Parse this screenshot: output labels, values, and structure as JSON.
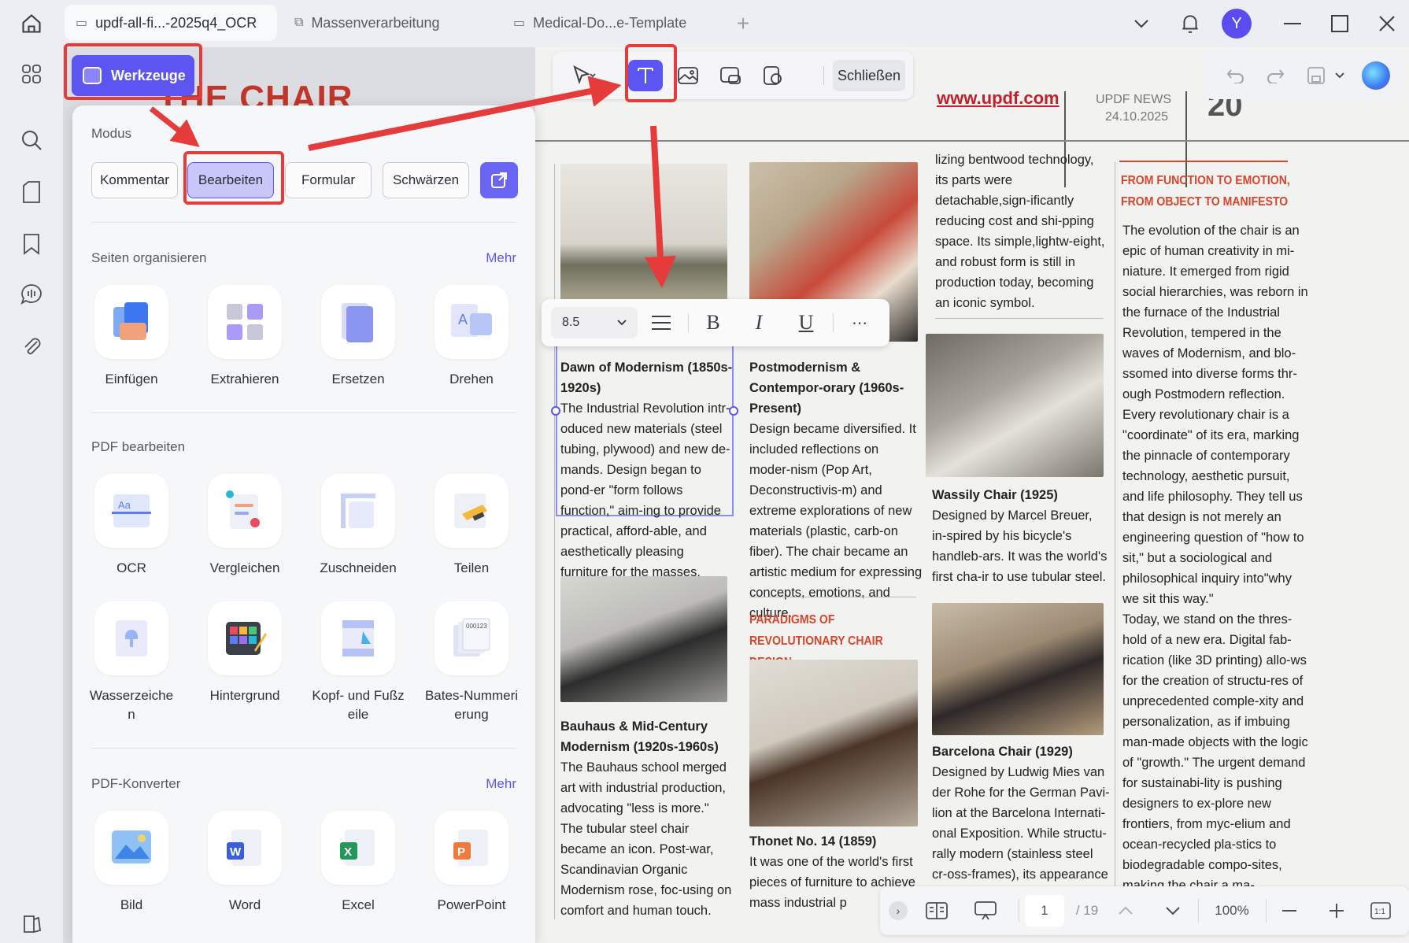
{
  "tabs": [
    {
      "label": "updf-all-fi...-2025q4_OCR",
      "active": true
    },
    {
      "label": "Massenverarbeitung",
      "active": false
    },
    {
      "label": "Medical-Do...e-Template",
      "active": false
    }
  ],
  "user": {
    "avatar_letter": "Y"
  },
  "toolbar": {
    "werkzeuge_label": "Werkzeuge",
    "close_label": "Schließen"
  },
  "panel": {
    "mode_title": "Modus",
    "modes": [
      "Kommentar",
      "Bearbeiten",
      "Formular",
      "Schwärzen"
    ],
    "active_mode": "Bearbeiten",
    "organize": {
      "title": "Seiten organisieren",
      "more": "Mehr",
      "tools": [
        "Einfügen",
        "Extrahieren",
        "Ersetzen",
        "Drehen"
      ]
    },
    "edit": {
      "title": "PDF bearbeiten",
      "tools": [
        "OCR",
        "Vergleichen",
        "Zuschneiden",
        "Teilen",
        "Wasserzeiche n",
        "Hintergrund",
        "Kopf- und Fußzeile",
        "Bates-Nummerierung"
      ]
    },
    "convert": {
      "title": "PDF-Konverter",
      "more": "Mehr",
      "tools": [
        "Bild",
        "Word",
        "Excel",
        "PowerPoint"
      ]
    }
  },
  "format_bar": {
    "font_size": "8.5"
  },
  "document": {
    "header_partial": "THE CHAIR",
    "url": "www.updf.com",
    "news_label": "UPDF NEWS",
    "date": "24.10.2025",
    "issue": "20",
    "col1": {
      "h1": "Dawn of Modernism (1850s-1920s)",
      "p1": "The Industrial Revolution intr-oduced new materials (steel tubing, plywood) and new de-mands. Design began to pond-er \"form follows function,\" aim-ing to provide practical, afford-able, and aesthetically pleasing furniture for the masses.",
      "h2": "Bauhaus & Mid-Century Modernism (1920s-1960s)",
      "p2": "The Bauhaus school merged art with industrial production, advocating \"less is more.\" The tubular steel chair became an icon. Post-war, Scandinavian Organic Modernism rose, foc-using on comfort and human touch."
    },
    "col2": {
      "h1": "Postmodernism & Contempor-orary (1960s-Present)",
      "p1": "Design became diversified. It included reflections on moder-nism (Pop Art, Deconstructivis-m) and extreme explorations of new materials (plastic, carb-on fiber). The chair became an artistic medium for expressing concepts, emotions, and culture.",
      "red_head": "PARADIGMS OF REVOLUTIONARY CHAIR DESIGN",
      "h2": "Thonet No. 14 (1859)",
      "p2": "It was one of the world's first pieces of furniture to achieve mass industrial p"
    },
    "col3": {
      "p0": "lizing bentwood technology, its parts were detachable,sign-ificantly reducing cost and shi-pping space. Its simple,lightw-eight, and robust form is still in production today, becoming an iconic symbol.",
      "h1": "Wassily Chair (1925)",
      "p1": "Designed by Marcel Breuer, in-spired by his bicycle's handleb-ars. It was the world's first cha-ir to use tubular steel.",
      "h2": "Barcelona Chair (1929)",
      "p2": "Designed by Ludwig Mies van der Rohe for the German Pavi-lion at the Barcelona Internati-onal Exposition. While structu-rally modern (stainless steel cr-oss-frames), its appearance is"
    },
    "col4": {
      "red_head": "FROM FUNCTION TO EMOTION, FROM OBJECT TO MANIFESTO",
      "p1": "The evolution of the chair is an epic of human creativity in mi-niature. It emerged from rigid social hierarchies, was reborn in the furnace of the Industrial Revolution, tempered in the waves of Modernism, and blo-ssomed into diverse forms thr-ough Postmodern reflection. Every revolutionary chair is a \"coordinate\" of its era, marking the pinnacle of contemporary technology, aesthetic pursuit, and life philosophy. They tell us that design is not merely an engineering question of \"how to sit,\" but a sociological and philosophical inquiry into\"why we sit this way.\"",
      "p2": "Today, we stand on the thres-hold of a new era. Digital fab-rication (like 3D printing) allo-ws for the creation of structu-res of unprecedented comple-xity and personalization, as if imbuing man-made objects with the logic of \"growth.\" The urgent demand for sustainabi-lity is pushing designers to ex-plore new frontiers, from myc-elium and ocean-recycled pla-stics to biodegradable compo-sites, making the chair a ma-"
    }
  },
  "pagination": {
    "current_page": "1",
    "total": "/ 19",
    "zoom": "100%"
  },
  "colors": {
    "accent": "#5c55f1",
    "highlight_red": "#e63b3b",
    "heading_red": "#d8452d"
  },
  "icons": [
    "home-icon",
    "grid-icon",
    "search-icon",
    "pages-icon",
    "bookmark-icon",
    "comment-icon",
    "attachment-icon",
    "layers-icon",
    "bell-icon",
    "chevron-down-icon",
    "minimize-icon",
    "maximize-icon",
    "close-icon",
    "cursor-icon",
    "text-edit-icon",
    "image-edit-icon",
    "link-icon",
    "stamp-icon",
    "undo-icon",
    "redo-icon",
    "save-icon",
    "ai-icon"
  ]
}
